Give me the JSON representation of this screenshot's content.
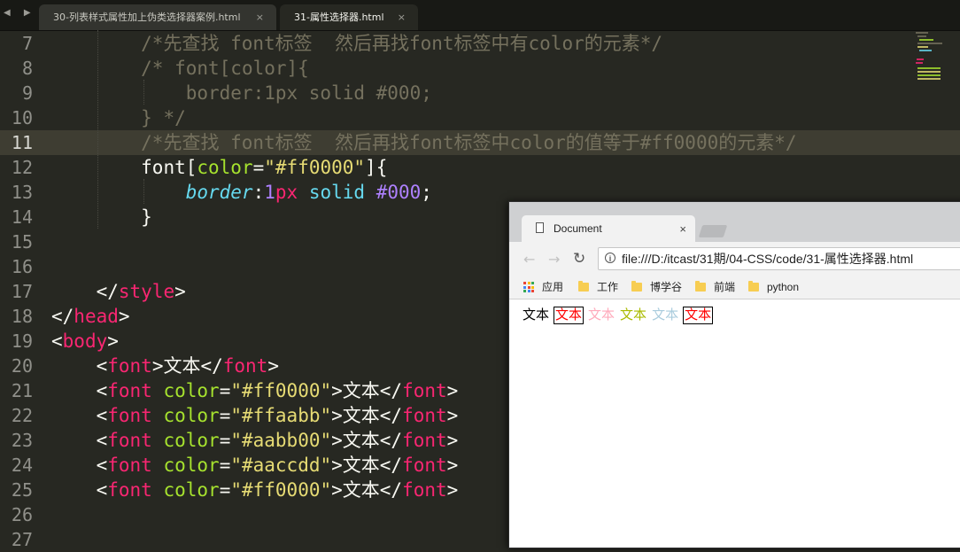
{
  "editor": {
    "tabs": [
      {
        "label": "30-列表样式属性加上伪类选择器案例.html",
        "active": false,
        "close": "×"
      },
      {
        "label": "31-属性选择器.html",
        "active": true,
        "close": "×"
      }
    ],
    "nav_arrows": "◀ ▶",
    "current_line": 11,
    "line_numbers": [
      "7",
      "8",
      "9",
      "10",
      "11",
      "12",
      "13",
      "14",
      "15",
      "16",
      "17",
      "18",
      "19",
      "20",
      "21",
      "22",
      "23",
      "24",
      "25",
      "26",
      "27"
    ],
    "colors": {
      "background": "#272822",
      "comment": "#75715e",
      "tag": "#f92672",
      "attribute": "#a6e22e",
      "string": "#e6db74",
      "property": "#66d9ef",
      "number": "#ae81ff"
    },
    "lines": [
      {
        "indent": "        ",
        "parts": [
          {
            "t": "/*先查找 font标签  然后再找font标签中有color的元素*/",
            "c": "cm"
          }
        ]
      },
      {
        "indent": "        ",
        "parts": [
          {
            "t": "/* font[color]{",
            "c": "cm"
          }
        ]
      },
      {
        "indent": "            ",
        "parts": [
          {
            "t": "border:1px solid #000;",
            "c": "cm"
          }
        ]
      },
      {
        "indent": "        ",
        "parts": [
          {
            "t": "} */",
            "c": "cm"
          }
        ]
      },
      {
        "indent": "        ",
        "parts": [
          {
            "t": "/*先查找 font标签  然后再找font标签中color的值等于#ff0000的元素*/",
            "c": "cm"
          }
        ]
      },
      {
        "indent": "        ",
        "parts": [
          {
            "t": "font[",
            "c": ""
          },
          {
            "t": "color",
            "c": "at"
          },
          {
            "t": "=",
            "c": ""
          },
          {
            "t": "\"#ff0000\"",
            "c": "st"
          },
          {
            "t": "]{",
            "c": ""
          }
        ]
      },
      {
        "indent": "            ",
        "parts": [
          {
            "t": "border",
            "c": "pr"
          },
          {
            "t": ":",
            "c": ""
          },
          {
            "t": "1",
            "c": "nm"
          },
          {
            "t": "px",
            "c": "tg"
          },
          {
            "t": " ",
            "c": ""
          },
          {
            "t": "solid",
            "c": "kw"
          },
          {
            "t": " ",
            "c": ""
          },
          {
            "t": "#000",
            "c": "nm"
          },
          {
            "t": ";",
            "c": ""
          }
        ]
      },
      {
        "indent": "        ",
        "parts": [
          {
            "t": "}",
            "c": ""
          }
        ]
      },
      {
        "indent": "",
        "parts": []
      },
      {
        "indent": "",
        "parts": []
      },
      {
        "indent": "    ",
        "parts": [
          {
            "t": "</",
            "c": ""
          },
          {
            "t": "style",
            "c": "tg"
          },
          {
            "t": ">",
            "c": ""
          }
        ]
      },
      {
        "indent": "",
        "parts": [
          {
            "t": "</",
            "c": ""
          },
          {
            "t": "head",
            "c": "tg"
          },
          {
            "t": ">",
            "c": ""
          }
        ]
      },
      {
        "indent": "",
        "parts": [
          {
            "t": "<",
            "c": ""
          },
          {
            "t": "body",
            "c": "tg"
          },
          {
            "t": ">",
            "c": ""
          }
        ]
      },
      {
        "indent": "    ",
        "parts": [
          {
            "t": "<",
            "c": ""
          },
          {
            "t": "font",
            "c": "tg"
          },
          {
            "t": ">文本</",
            "c": ""
          },
          {
            "t": "font",
            "c": "tg"
          },
          {
            "t": ">",
            "c": ""
          }
        ]
      },
      {
        "indent": "    ",
        "parts": [
          {
            "t": "<",
            "c": ""
          },
          {
            "t": "font",
            "c": "tg"
          },
          {
            "t": " ",
            "c": ""
          },
          {
            "t": "color",
            "c": "at"
          },
          {
            "t": "=",
            "c": ""
          },
          {
            "t": "\"#ff0000\"",
            "c": "st"
          },
          {
            "t": ">文本</",
            "c": ""
          },
          {
            "t": "font",
            "c": "tg"
          },
          {
            "t": ">",
            "c": ""
          }
        ]
      },
      {
        "indent": "    ",
        "parts": [
          {
            "t": "<",
            "c": ""
          },
          {
            "t": "font",
            "c": "tg"
          },
          {
            "t": " ",
            "c": ""
          },
          {
            "t": "color",
            "c": "at"
          },
          {
            "t": "=",
            "c": ""
          },
          {
            "t": "\"#ffaabb\"",
            "c": "st"
          },
          {
            "t": ">文本</",
            "c": ""
          },
          {
            "t": "font",
            "c": "tg"
          },
          {
            "t": ">",
            "c": ""
          }
        ]
      },
      {
        "indent": "    ",
        "parts": [
          {
            "t": "<",
            "c": ""
          },
          {
            "t": "font",
            "c": "tg"
          },
          {
            "t": " ",
            "c": ""
          },
          {
            "t": "color",
            "c": "at"
          },
          {
            "t": "=",
            "c": ""
          },
          {
            "t": "\"#aabb00\"",
            "c": "st"
          },
          {
            "t": ">文本</",
            "c": ""
          },
          {
            "t": "font",
            "c": "tg"
          },
          {
            "t": ">",
            "c": ""
          }
        ]
      },
      {
        "indent": "    ",
        "parts": [
          {
            "t": "<",
            "c": ""
          },
          {
            "t": "font",
            "c": "tg"
          },
          {
            "t": " ",
            "c": ""
          },
          {
            "t": "color",
            "c": "at"
          },
          {
            "t": "=",
            "c": ""
          },
          {
            "t": "\"#aaccdd\"",
            "c": "st"
          },
          {
            "t": ">文本</",
            "c": ""
          },
          {
            "t": "font",
            "c": "tg"
          },
          {
            "t": ">",
            "c": ""
          }
        ]
      },
      {
        "indent": "    ",
        "parts": [
          {
            "t": "<",
            "c": ""
          },
          {
            "t": "font",
            "c": "tg"
          },
          {
            "t": " ",
            "c": ""
          },
          {
            "t": "color",
            "c": "at"
          },
          {
            "t": "=",
            "c": ""
          },
          {
            "t": "\"#ff0000\"",
            "c": "st"
          },
          {
            "t": ">文本</",
            "c": ""
          },
          {
            "t": "font",
            "c": "tg"
          },
          {
            "t": ">",
            "c": ""
          }
        ]
      },
      {
        "indent": "",
        "parts": []
      },
      {
        "indent": "",
        "parts": []
      }
    ]
  },
  "browser": {
    "tab_title": "Document",
    "tab_close": "×",
    "back": "←",
    "forward": "→",
    "reload": "↻",
    "info_icon": "i",
    "url": "file:///D:/itcast/31期/04-CSS/code/31-属性选择器.html",
    "bookmarks": [
      {
        "label": "应用",
        "icon": "apps-grid-icon"
      },
      {
        "label": "工作",
        "icon": "folder-icon"
      },
      {
        "label": "博学谷",
        "icon": "folder-icon"
      },
      {
        "label": "前端",
        "icon": "folder-icon"
      },
      {
        "label": "python",
        "icon": "folder-icon"
      }
    ],
    "page_words": [
      {
        "text": "文本",
        "color": "#000000",
        "bordered": false
      },
      {
        "text": "文本",
        "color": "#ff0000",
        "bordered": true
      },
      {
        "text": "文本",
        "color": "#ffaabb",
        "bordered": false
      },
      {
        "text": "文本",
        "color": "#aabb00",
        "bordered": false
      },
      {
        "text": "文本",
        "color": "#aaccdd",
        "bordered": false
      },
      {
        "text": "文本",
        "color": "#ff0000",
        "bordered": true
      }
    ]
  }
}
